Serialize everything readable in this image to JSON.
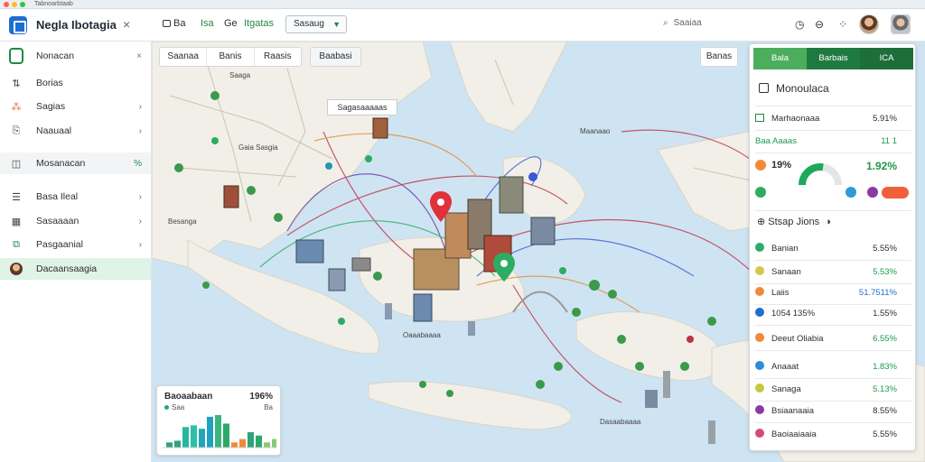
{
  "browser": {
    "tab_title": "Tabnoarbtaab"
  },
  "header": {
    "app_title": "Negla Ibotagia",
    "close_label": "×",
    "toolbar": [
      {
        "label": "Ba",
        "style": "plain"
      },
      {
        "label": "Isa",
        "style": "green"
      },
      {
        "label": "Ge",
        "style": "plain"
      },
      {
        "label": "Itgatas",
        "style": "green"
      }
    ],
    "select_value": "Sasaug",
    "search_placeholder": "Saaiaa",
    "icons": [
      "clock-icon",
      "globe-icon",
      "apps-icon"
    ]
  },
  "sidebar": {
    "close_label": "×",
    "items": [
      {
        "label": "Nonacan",
        "icon": "logo-icon",
        "arrow": "×",
        "state": ""
      },
      {
        "label": "Borias",
        "icon": "route-icon",
        "arrow": "",
        "state": ""
      },
      {
        "label": "Sagias",
        "icon": "network-icon",
        "arrow": "›",
        "state": ""
      },
      {
        "label": "Naauaal",
        "icon": "document-icon",
        "arrow": "›",
        "state": ""
      },
      {
        "label": "Mosanacan",
        "icon": "analytics-icon",
        "arrow": "%",
        "state": "hl"
      },
      {
        "label": "Basa Ileal",
        "icon": "sliders-icon",
        "arrow": "›",
        "state": ""
      },
      {
        "label": "Sasaaaan",
        "icon": "grid-icon",
        "arrow": "›",
        "state": ""
      },
      {
        "label": "Pasgaanial",
        "icon": "stack-icon",
        "arrow": "›",
        "state": ""
      },
      {
        "label": "Dacaansaagia",
        "icon": "user-icon",
        "arrow": "",
        "state": "active"
      }
    ]
  },
  "map": {
    "filter_tabs": [
      "Saanaa",
      "Banis",
      "Raasis"
    ],
    "dropdown_label": "Baabasi",
    "right_button": "Banas",
    "tooltip": "Sagasaaaaas",
    "labels": [
      "Saaga",
      "Besanga",
      "Gaia Sasgia",
      "Oaaabaaaa",
      "Maanaao",
      "Dasaabaaaa"
    ]
  },
  "chart_card": {
    "title": "Baoaabaan",
    "value": "196%",
    "legend": [
      "Saa",
      "Ba"
    ],
    "bars": [
      3,
      4,
      12,
      13,
      11,
      18,
      19,
      14,
      3,
      5,
      9,
      7,
      3,
      5
    ],
    "colors": [
      "#2ea37c",
      "#2ea37c",
      "#28b5a0",
      "#2cc0a8",
      "#24a5b8",
      "#22a0c0",
      "#3ab57d",
      "#2ea86a",
      "#f08a3a",
      "#f08a3a",
      "#2ea37c",
      "#2ea86a",
      "#8acb6d",
      "#8acb6d"
    ]
  },
  "panel": {
    "tabs": [
      {
        "label": "Bala",
        "color": "#4cae5c"
      },
      {
        "label": "Barbais",
        "color": "#1f7a40"
      },
      {
        "label": "ICA",
        "color": "#1e6e3a"
      }
    ],
    "title": "Monoulaca",
    "metrics": [
      {
        "icon": "chart-icon",
        "label": "Marhaonaaa",
        "value": "5.91%",
        "accent": ""
      },
      {
        "icon": "",
        "label": "Baa Aaaas",
        "value": "11 1",
        "accent": "green"
      }
    ],
    "gauge": {
      "left_label": "19%",
      "value": "1.92%",
      "fraction": 0.55,
      "bottom_icons": [
        "badge-icon",
        "drop-icon",
        "timer-icon",
        "toggle-icon"
      ]
    },
    "section": {
      "title": "Stsap Jions",
      "icon": "refresh-icon"
    },
    "rows": [
      {
        "label": "Banian",
        "value": "5.55%",
        "color": "#2eac63",
        "accent": ""
      },
      {
        "label": "Sanaan",
        "value": "5.53%",
        "color": "#d4c84a",
        "accent": "green"
      },
      {
        "label": "Laiis",
        "value": "51.7511%",
        "color": "#f08a3a",
        "accent": "blue"
      },
      {
        "label": "1054 135%",
        "value": "1.55%",
        "color": "#1f6fd1",
        "accent": ""
      },
      {
        "label": "Deeut Oliabia",
        "value": "6.55%",
        "color": "#f08a3a",
        "accent": "green"
      },
      {
        "label": "Anaaat",
        "value": "1.83%",
        "color": "#2f8ad8",
        "accent": "green"
      },
      {
        "label": "Sanaga",
        "value": "5.13%",
        "color": "#c2c93a",
        "accent": "green"
      },
      {
        "label": "Bsiaanaaia",
        "value": "8.55%",
        "color": "#8a3aa5",
        "accent": ""
      },
      {
        "label": "Baoiaaiaaia",
        "value": "5.55%",
        "color": "#d44a7a",
        "accent": ""
      }
    ]
  },
  "colors": {
    "accent": "#1f8a45",
    "map_water": "#cfe4f2",
    "map_land": "#f1efe8"
  }
}
